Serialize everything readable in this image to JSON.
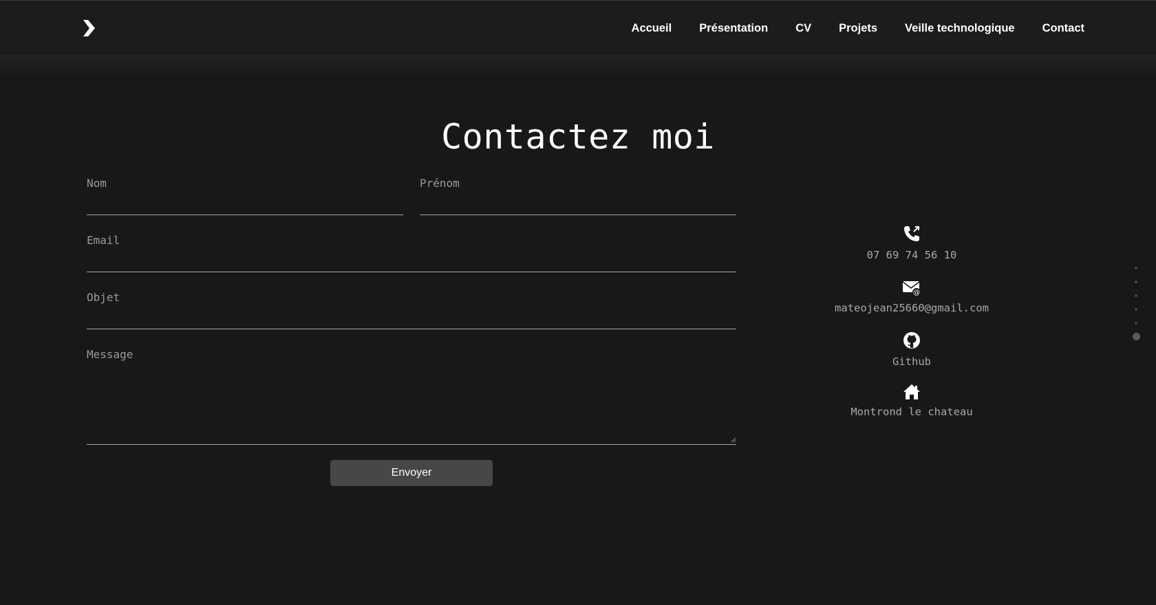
{
  "nav": {
    "items": [
      {
        "label": "Accueil"
      },
      {
        "label": "Présentation"
      },
      {
        "label": "CV"
      },
      {
        "label": "Projets"
      },
      {
        "label": "Veille technologique"
      },
      {
        "label": "Contact"
      }
    ]
  },
  "page": {
    "title": "Contactez moi"
  },
  "form": {
    "nom_label": "Nom",
    "prenom_label": "Prénom",
    "email_label": "Email",
    "objet_label": "Objet",
    "message_label": "Message",
    "submit_label": "Envoyer"
  },
  "contact": {
    "phone": "07 69 74 56 10",
    "email": "mateojean25660@gmail.com",
    "github": "Github",
    "location": "Montrond le chateau"
  },
  "icons": [
    "chevron-right-icon",
    "phone-icon",
    "mail-icon",
    "github-icon",
    "home-icon"
  ],
  "colors": {
    "background": "#181818",
    "header": "#1c1c1c",
    "button": "#474747",
    "text_muted": "#a9a9a9"
  }
}
